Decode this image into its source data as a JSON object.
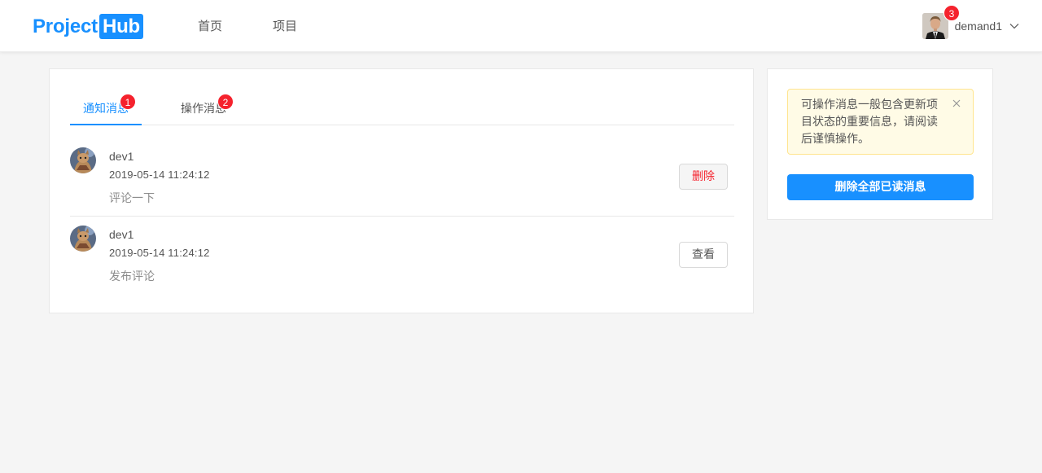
{
  "header": {
    "logo_part1": "Project",
    "logo_part2": "Hub",
    "nav": [
      "首页",
      "项目"
    ],
    "user": {
      "name": "demand1",
      "notification_count": "3",
      "avatar_icon": "user-avatar-icon",
      "dropdown_icon": "chevron-down-icon"
    }
  },
  "tabs": [
    {
      "label": "通知消息",
      "badge": "1",
      "active": true
    },
    {
      "label": "操作消息",
      "badge": "2",
      "active": false
    }
  ],
  "messages": [
    {
      "author": "dev1",
      "time": "2019-05-14 11:24:12",
      "content": "评论一下",
      "action": "删除"
    },
    {
      "author": "dev1",
      "time": "2019-05-14 11:24:12",
      "content": "发布评论",
      "action": "查看"
    }
  ],
  "sidebar": {
    "alert": "可操作消息一般包含更新项目状态的重要信息，请阅读后谨慎操作。",
    "delete_all": "删除全部已读消息"
  },
  "colors": {
    "primary": "#1890ff",
    "danger": "#f5222d",
    "alert_bg": "#fffbe6",
    "alert_border": "#ffe58f"
  }
}
